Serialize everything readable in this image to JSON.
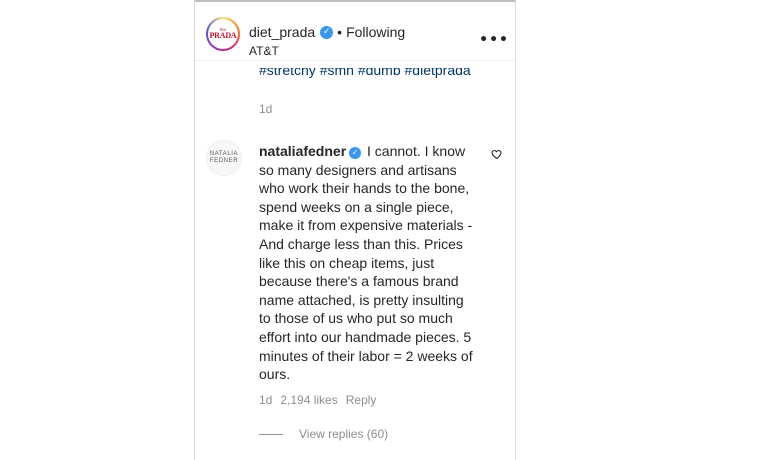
{
  "post": {
    "username": "diet_prada",
    "follow_status": "Following",
    "location": "AT&T",
    "avatar_text_top": "Diet",
    "avatar_text_main": "PRADA",
    "more_icon": "•••",
    "hashtags": "#stretchy #smh #dumb #dietprada",
    "time": "1d"
  },
  "comment": {
    "avatar_line1": "NATALIA",
    "avatar_line2": "FEDNER",
    "username": "nataliafedner",
    "text": "I cannot. I know so many designers and artisans who work their hands to the bone, spend weeks on a single piece, make it from expensive materials - And charge less than this. Prices like this on cheap items, just because there's a famous brand name attached, is pretty insulting to those of us who put so much effort into our handmade pieces. 5 minutes of their labor = 2 weeks of ours.",
    "time": "1d",
    "likes": "2,194 likes",
    "reply_label": "Reply",
    "view_replies": "View replies (60)"
  },
  "colors": {
    "verified": "#3897f0",
    "secondary_text": "#8e8e8e",
    "hashtag": "#00376b"
  }
}
